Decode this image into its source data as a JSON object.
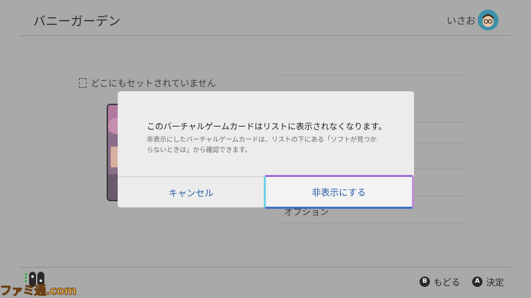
{
  "header": {
    "app_title": "バニーガーデン",
    "user_name": "いさお"
  },
  "left_panel": {
    "unset_status": "どこにもセットされていません"
  },
  "menu": {
    "visible_item": "オプション"
  },
  "dialog": {
    "message": "このバーチャルゲームカードはリストに表示されなくなります。",
    "sub_message_lines": [
      "非表示にしたバーチャルゲームカードは、リストの下にある「ソフトが見つか",
      "らないときは」から確認できます。"
    ],
    "cancel_label": "キャンセル",
    "hide_label": "非表示にする"
  },
  "footer": {
    "hints": [
      {
        "button": "B",
        "label": "もどる"
      },
      {
        "button": "A",
        "label": "決定"
      }
    ]
  },
  "watermark": "ファミ通.com",
  "colors": {
    "accent_text": "#2a5fa6",
    "overlay_background": "#a9a9a9",
    "dialog_background": "#ececec"
  }
}
